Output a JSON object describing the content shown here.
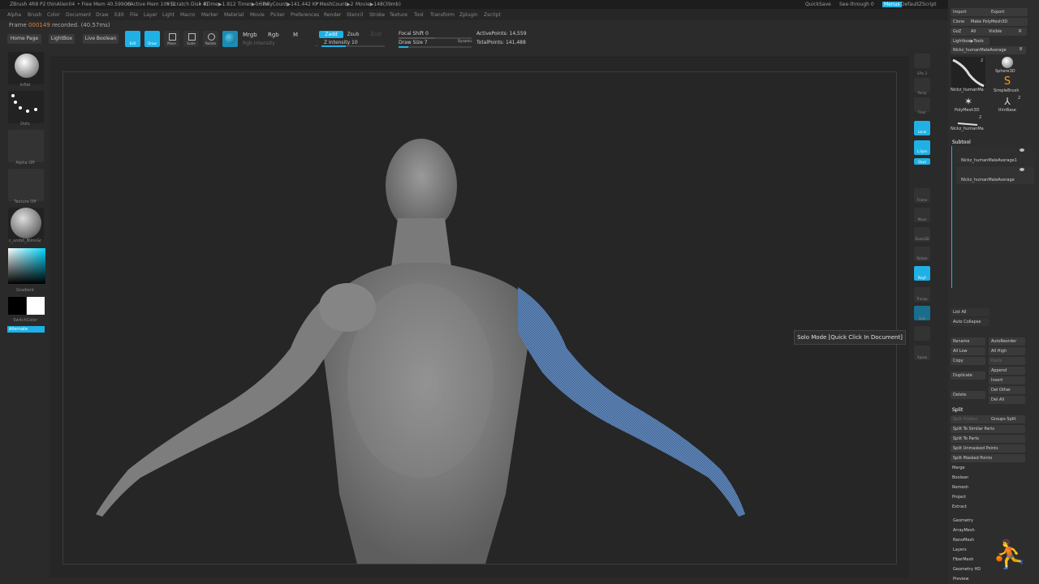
{
  "title_bar": {
    "app": "ZBrush 4R8 P2",
    "doc": "thinAlien04",
    "free_mem": "• Free Mem 40.599GB",
    "active_mem": "• Active Mem 10911",
    "scratch": "• Scratch Disk 41",
    "rtime": "• RTime▶1.912 Timer▶0.504",
    "poly": "• PolyCount▶141.442 KP",
    "mesh": "• MeshCount▶2",
    "movie": "Movie▶148(39mb)",
    "quicksave": "QuickSave",
    "see_through": "See-through 0",
    "menus": "Menus",
    "script": "DefaultZScript"
  },
  "menu_bar": [
    "Alpha",
    "Brush",
    "Color",
    "Document",
    "Draw",
    "Edit",
    "File",
    "Layer",
    "Light",
    "Macro",
    "Marker",
    "Material",
    "Movie",
    "Picker",
    "Preferences",
    "Render",
    "Stencil",
    "Stroke",
    "Texture",
    "Tool",
    "Transform",
    "Zplugin",
    "Zscript"
  ],
  "frame_info": {
    "label": "Frame",
    "value": "000149",
    "rest": "recorded. (40.57ms)"
  },
  "toolshelf": {
    "home_page": "Home Page",
    "lightbox": "LightBox",
    "live_boolean": "Live Boolean",
    "edit": "Edit",
    "draw": "Draw",
    "move": "Move",
    "scale": "Scale",
    "rotate": "Rotate",
    "mrgb": "Mrgb",
    "rgb": "Rgb",
    "m": "M",
    "rgb_intensity": "Rgb Intensity",
    "zadd": "Zadd",
    "zsub": "Zsub",
    "zcut": "Zcut",
    "z_intensity": "Z Intensity 10",
    "focal_shift": "Focal Shift 0",
    "draw_size": "Draw Size 7",
    "dynamic": "Dynamic",
    "active_points": "ActivePoints: 14,559",
    "total_points": "TotalPoints: 141,488"
  },
  "left_panel": {
    "brush": "Inflat",
    "stroke": "Dots",
    "alpha": "Alpha Off",
    "texture": "Texture Off",
    "material": "c_undst_BlinnGr",
    "gradient": "Gradient",
    "switch_color": "SwitchColor",
    "alternate": "Alternate"
  },
  "right_shelf": [
    "SPix 3",
    "Persp",
    "Floor",
    "Local",
    "L.Sym",
    "Qxyz",
    "Frame",
    "Move",
    "Zoom3D",
    "Rotate",
    "PolyF",
    "Transp",
    "Solo",
    "Xpose"
  ],
  "tooltip": "Solo Mode [Quick Click In Document]",
  "tool_panel": {
    "import": "Import",
    "export": "Export",
    "clone": "Clone",
    "make_polymesh": "Make PolyMesh3D",
    "goz": "GoZ",
    "all": "All",
    "visible": "Visible",
    "r": "R",
    "lightbox_tools": "Lightbox▶Tools",
    "current_tool": "Nickz_humanMaleAverage",
    "current_tool_count": "8",
    "tools": [
      {
        "label": "Nickz_humanMa",
        "count": "2"
      },
      {
        "label": "Sphere3D",
        "count": ""
      },
      {
        "label": "SimpleBrush",
        "count": ""
      },
      {
        "label": "PolyMesh3D",
        "count": ""
      },
      {
        "label": "thinBase",
        "count": "2"
      },
      {
        "label": "Nickz_humanMa",
        "count": "2"
      }
    ],
    "subtool_header": "Subtool",
    "subtools": [
      "Nickz_humanMaleAverage1",
      "Nickz_humanMaleAverage"
    ],
    "list_all": "List All",
    "auto_collapse": "Auto Collapse",
    "rename": "Rename",
    "auto_reorder": "AutoReorder",
    "all_low": "All Low",
    "all_high": "All High",
    "copy": "Copy",
    "paste": "Paste",
    "append": "Append",
    "duplicate": "Duplicate",
    "insert": "Insert",
    "delete": "Delete",
    "del_other": "Del Other",
    "del_all": "Del All",
    "split_header": "Split",
    "split_hidden": "Split Hidden",
    "groups_split": "Groups Split",
    "split_similar": "Split To Similar Parts",
    "split_parts": "Split To Parts",
    "split_unmasked": "Split Unmasked Points",
    "split_masked": "Split Masked Points",
    "sections": [
      "Merge",
      "Boolean",
      "Remesh",
      "Project",
      "Extract"
    ],
    "subpalettes": [
      "Geometry",
      "ArrayMesh",
      "NanoMesh",
      "Layers",
      "FiberMesh",
      "Geometry HD",
      "Preview"
    ]
  },
  "colors": {
    "accent": "#1fb1e6",
    "panel": "#2d2d2d",
    "mesh": "#8a8a8a",
    "masked": "#5f86b8"
  }
}
